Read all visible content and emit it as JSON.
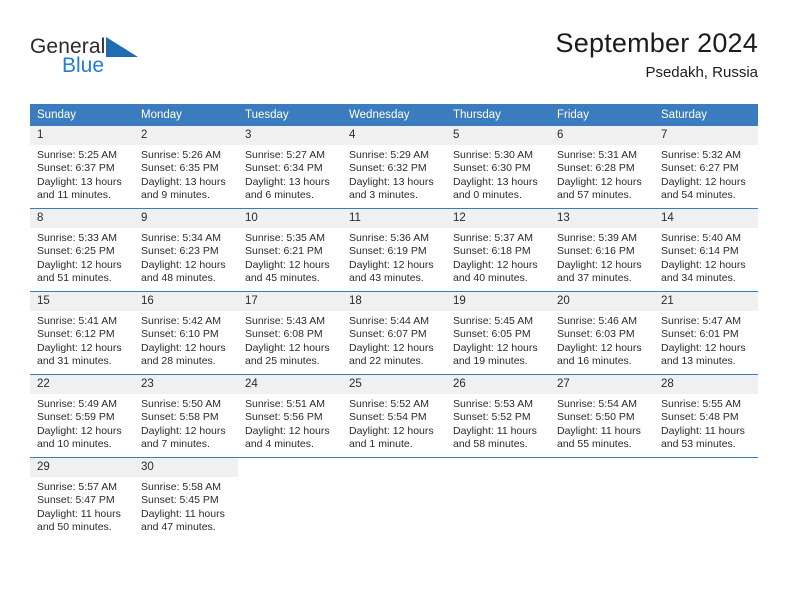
{
  "brand": {
    "name_part1": "General",
    "name_part2": "Blue",
    "logo_icon": "triangle-logo-icon",
    "accent_color": "#1f7fd0"
  },
  "header": {
    "title": "September 2024",
    "location": "Psedakh, Russia"
  },
  "calendar": {
    "header_color": "#3a7cbe",
    "daynum_band_color": "#f0f0f0",
    "weekdays": [
      "Sunday",
      "Monday",
      "Tuesday",
      "Wednesday",
      "Thursday",
      "Friday",
      "Saturday"
    ],
    "weeks": [
      [
        {
          "day": "1",
          "sunrise": "Sunrise: 5:25 AM",
          "sunset": "Sunset: 6:37 PM",
          "daylight_line1": "Daylight: 13 hours",
          "daylight_line2": "and 11 minutes."
        },
        {
          "day": "2",
          "sunrise": "Sunrise: 5:26 AM",
          "sunset": "Sunset: 6:35 PM",
          "daylight_line1": "Daylight: 13 hours",
          "daylight_line2": "and 9 minutes."
        },
        {
          "day": "3",
          "sunrise": "Sunrise: 5:27 AM",
          "sunset": "Sunset: 6:34 PM",
          "daylight_line1": "Daylight: 13 hours",
          "daylight_line2": "and 6 minutes."
        },
        {
          "day": "4",
          "sunrise": "Sunrise: 5:29 AM",
          "sunset": "Sunset: 6:32 PM",
          "daylight_line1": "Daylight: 13 hours",
          "daylight_line2": "and 3 minutes."
        },
        {
          "day": "5",
          "sunrise": "Sunrise: 5:30 AM",
          "sunset": "Sunset: 6:30 PM",
          "daylight_line1": "Daylight: 13 hours",
          "daylight_line2": "and 0 minutes."
        },
        {
          "day": "6",
          "sunrise": "Sunrise: 5:31 AM",
          "sunset": "Sunset: 6:28 PM",
          "daylight_line1": "Daylight: 12 hours",
          "daylight_line2": "and 57 minutes."
        },
        {
          "day": "7",
          "sunrise": "Sunrise: 5:32 AM",
          "sunset": "Sunset: 6:27 PM",
          "daylight_line1": "Daylight: 12 hours",
          "daylight_line2": "and 54 minutes."
        }
      ],
      [
        {
          "day": "8",
          "sunrise": "Sunrise: 5:33 AM",
          "sunset": "Sunset: 6:25 PM",
          "daylight_line1": "Daylight: 12 hours",
          "daylight_line2": "and 51 minutes."
        },
        {
          "day": "9",
          "sunrise": "Sunrise: 5:34 AM",
          "sunset": "Sunset: 6:23 PM",
          "daylight_line1": "Daylight: 12 hours",
          "daylight_line2": "and 48 minutes."
        },
        {
          "day": "10",
          "sunrise": "Sunrise: 5:35 AM",
          "sunset": "Sunset: 6:21 PM",
          "daylight_line1": "Daylight: 12 hours",
          "daylight_line2": "and 45 minutes."
        },
        {
          "day": "11",
          "sunrise": "Sunrise: 5:36 AM",
          "sunset": "Sunset: 6:19 PM",
          "daylight_line1": "Daylight: 12 hours",
          "daylight_line2": "and 43 minutes."
        },
        {
          "day": "12",
          "sunrise": "Sunrise: 5:37 AM",
          "sunset": "Sunset: 6:18 PM",
          "daylight_line1": "Daylight: 12 hours",
          "daylight_line2": "and 40 minutes."
        },
        {
          "day": "13",
          "sunrise": "Sunrise: 5:39 AM",
          "sunset": "Sunset: 6:16 PM",
          "daylight_line1": "Daylight: 12 hours",
          "daylight_line2": "and 37 minutes."
        },
        {
          "day": "14",
          "sunrise": "Sunrise: 5:40 AM",
          "sunset": "Sunset: 6:14 PM",
          "daylight_line1": "Daylight: 12 hours",
          "daylight_line2": "and 34 minutes."
        }
      ],
      [
        {
          "day": "15",
          "sunrise": "Sunrise: 5:41 AM",
          "sunset": "Sunset: 6:12 PM",
          "daylight_line1": "Daylight: 12 hours",
          "daylight_line2": "and 31 minutes."
        },
        {
          "day": "16",
          "sunrise": "Sunrise: 5:42 AM",
          "sunset": "Sunset: 6:10 PM",
          "daylight_line1": "Daylight: 12 hours",
          "daylight_line2": "and 28 minutes."
        },
        {
          "day": "17",
          "sunrise": "Sunrise: 5:43 AM",
          "sunset": "Sunset: 6:08 PM",
          "daylight_line1": "Daylight: 12 hours",
          "daylight_line2": "and 25 minutes."
        },
        {
          "day": "18",
          "sunrise": "Sunrise: 5:44 AM",
          "sunset": "Sunset: 6:07 PM",
          "daylight_line1": "Daylight: 12 hours",
          "daylight_line2": "and 22 minutes."
        },
        {
          "day": "19",
          "sunrise": "Sunrise: 5:45 AM",
          "sunset": "Sunset: 6:05 PM",
          "daylight_line1": "Daylight: 12 hours",
          "daylight_line2": "and 19 minutes."
        },
        {
          "day": "20",
          "sunrise": "Sunrise: 5:46 AM",
          "sunset": "Sunset: 6:03 PM",
          "daylight_line1": "Daylight: 12 hours",
          "daylight_line2": "and 16 minutes."
        },
        {
          "day": "21",
          "sunrise": "Sunrise: 5:47 AM",
          "sunset": "Sunset: 6:01 PM",
          "daylight_line1": "Daylight: 12 hours",
          "daylight_line2": "and 13 minutes."
        }
      ],
      [
        {
          "day": "22",
          "sunrise": "Sunrise: 5:49 AM",
          "sunset": "Sunset: 5:59 PM",
          "daylight_line1": "Daylight: 12 hours",
          "daylight_line2": "and 10 minutes."
        },
        {
          "day": "23",
          "sunrise": "Sunrise: 5:50 AM",
          "sunset": "Sunset: 5:58 PM",
          "daylight_line1": "Daylight: 12 hours",
          "daylight_line2": "and 7 minutes."
        },
        {
          "day": "24",
          "sunrise": "Sunrise: 5:51 AM",
          "sunset": "Sunset: 5:56 PM",
          "daylight_line1": "Daylight: 12 hours",
          "daylight_line2": "and 4 minutes."
        },
        {
          "day": "25",
          "sunrise": "Sunrise: 5:52 AM",
          "sunset": "Sunset: 5:54 PM",
          "daylight_line1": "Daylight: 12 hours",
          "daylight_line2": "and 1 minute."
        },
        {
          "day": "26",
          "sunrise": "Sunrise: 5:53 AM",
          "sunset": "Sunset: 5:52 PM",
          "daylight_line1": "Daylight: 11 hours",
          "daylight_line2": "and 58 minutes."
        },
        {
          "day": "27",
          "sunrise": "Sunrise: 5:54 AM",
          "sunset": "Sunset: 5:50 PM",
          "daylight_line1": "Daylight: 11 hours",
          "daylight_line2": "and 55 minutes."
        },
        {
          "day": "28",
          "sunrise": "Sunrise: 5:55 AM",
          "sunset": "Sunset: 5:48 PM",
          "daylight_line1": "Daylight: 11 hours",
          "daylight_line2": "and 53 minutes."
        }
      ],
      [
        {
          "day": "29",
          "sunrise": "Sunrise: 5:57 AM",
          "sunset": "Sunset: 5:47 PM",
          "daylight_line1": "Daylight: 11 hours",
          "daylight_line2": "and 50 minutes."
        },
        {
          "day": "30",
          "sunrise": "Sunrise: 5:58 AM",
          "sunset": "Sunset: 5:45 PM",
          "daylight_line1": "Daylight: 11 hours",
          "daylight_line2": "and 47 minutes."
        },
        {
          "day": "",
          "sunrise": "",
          "sunset": "",
          "daylight_line1": "",
          "daylight_line2": ""
        },
        {
          "day": "",
          "sunrise": "",
          "sunset": "",
          "daylight_line1": "",
          "daylight_line2": ""
        },
        {
          "day": "",
          "sunrise": "",
          "sunset": "",
          "daylight_line1": "",
          "daylight_line2": ""
        },
        {
          "day": "",
          "sunrise": "",
          "sunset": "",
          "daylight_line1": "",
          "daylight_line2": ""
        },
        {
          "day": "",
          "sunrise": "",
          "sunset": "",
          "daylight_line1": "",
          "daylight_line2": ""
        }
      ]
    ]
  }
}
